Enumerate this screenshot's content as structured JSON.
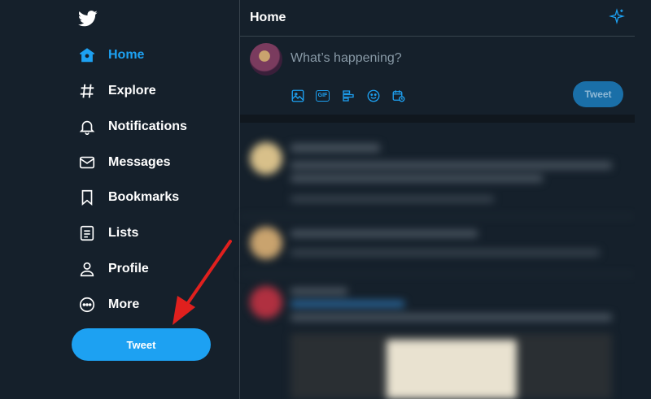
{
  "sidebar": {
    "items": [
      {
        "label": "Home",
        "icon": "home-icon",
        "active": true
      },
      {
        "label": "Explore",
        "icon": "hashtag-icon"
      },
      {
        "label": "Notifications",
        "icon": "bell-icon"
      },
      {
        "label": "Messages",
        "icon": "envelope-icon"
      },
      {
        "label": "Bookmarks",
        "icon": "bookmark-icon"
      },
      {
        "label": "Lists",
        "icon": "list-icon"
      },
      {
        "label": "Profile",
        "icon": "person-icon"
      },
      {
        "label": "More",
        "icon": "more-icon"
      }
    ],
    "tweet_label": "Tweet"
  },
  "header": {
    "title": "Home"
  },
  "composer": {
    "placeholder": "What’s happening?",
    "tools": [
      "image-icon",
      "gif-icon",
      "poll-icon",
      "emoji-icon",
      "schedule-icon"
    ],
    "tweet_label": "Tweet",
    "gif_label": "GIF"
  },
  "colors": {
    "accent": "#1da1f2",
    "background": "#15202b",
    "border": "#38444d"
  }
}
